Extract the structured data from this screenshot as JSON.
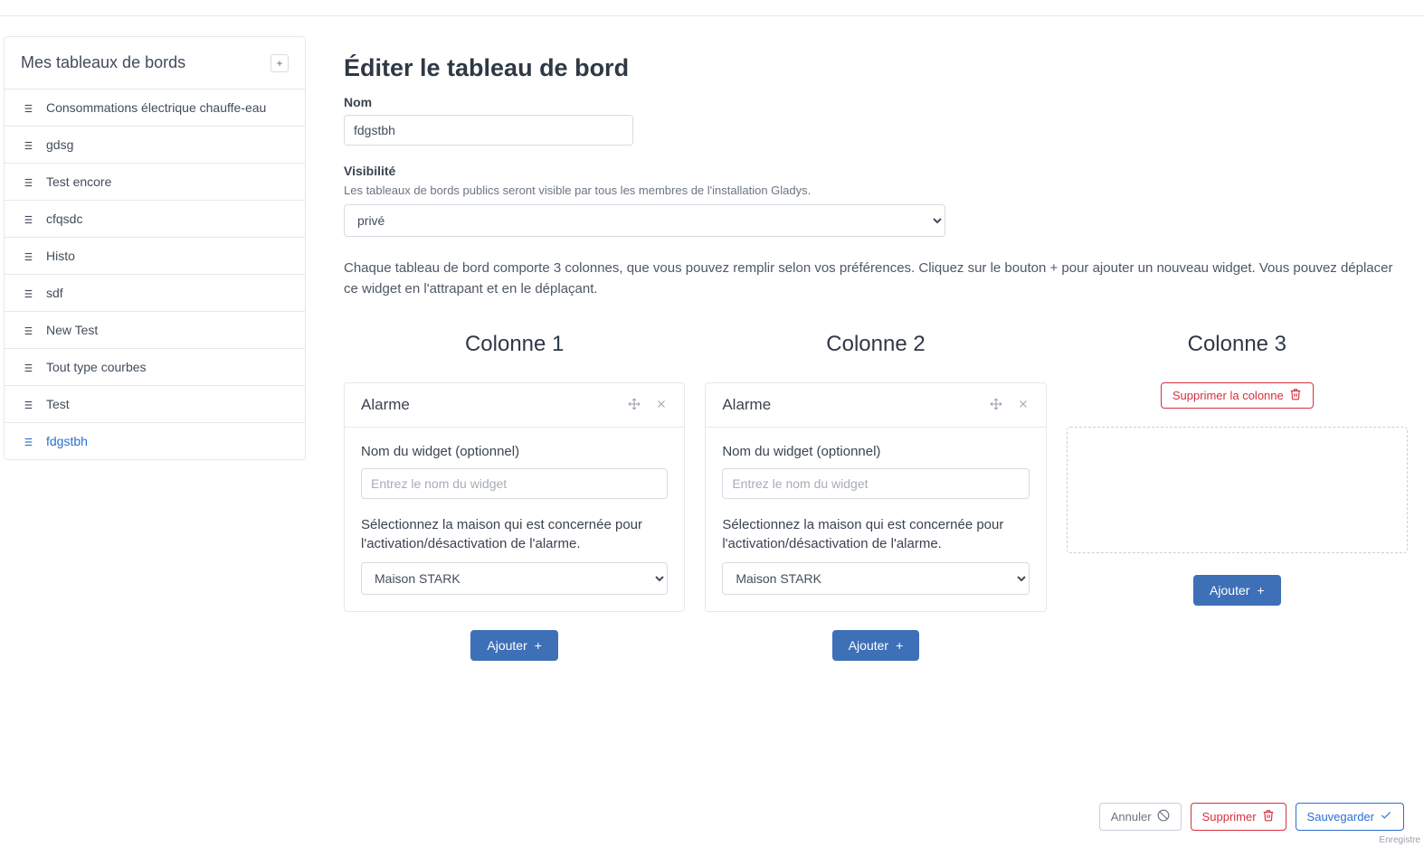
{
  "sidebar": {
    "title": "Mes tableaux de bords",
    "items": [
      {
        "label": "Consommations électrique chauffe-eau"
      },
      {
        "label": "gdsg"
      },
      {
        "label": "Test encore"
      },
      {
        "label": "cfqsdc"
      },
      {
        "label": "Histo"
      },
      {
        "label": "sdf"
      },
      {
        "label": "New Test"
      },
      {
        "label": "Tout type courbes"
      },
      {
        "label": "Test"
      },
      {
        "label": "fdgstbh"
      }
    ],
    "activeIndex": 9
  },
  "editor": {
    "title": "Éditer le tableau de bord",
    "nameLabel": "Nom",
    "nameValue": "fdgstbh",
    "visibilityLabel": "Visibilité",
    "visibilityHint": "Les tableaux de bords publics seront visible par tous les membres de l'installation Gladys.",
    "visibilityValue": "privé",
    "columnsHint": "Chaque tableau de bord comporte 3 colonnes, que vous pouvez remplir selon vos préférences. Cliquez sur le bouton + pour ajouter un nouveau widget. Vous pouvez déplacer ce widget en l'attrapant et en le déplaçant."
  },
  "columns": {
    "col1": {
      "title": "Colonne 1",
      "addLabel": "Ajouter"
    },
    "col2": {
      "title": "Colonne 2",
      "addLabel": "Ajouter"
    },
    "col3": {
      "title": "Colonne 3",
      "addLabel": "Ajouter",
      "deleteLabel": "Supprimer la colonne"
    }
  },
  "widget": {
    "title": "Alarme",
    "nameLabel": "Nom du widget (optionnel)",
    "namePlaceholder": "Entrez le nom du widget",
    "houseDesc": "Sélectionnez la maison qui est concernée pour l'activation/désactivation de l'alarme.",
    "houseValue": "Maison STARK"
  },
  "footer": {
    "cancel": "Annuler",
    "delete": "Supprimer",
    "save": "Sauvegarder",
    "corner": "Enregistre"
  }
}
